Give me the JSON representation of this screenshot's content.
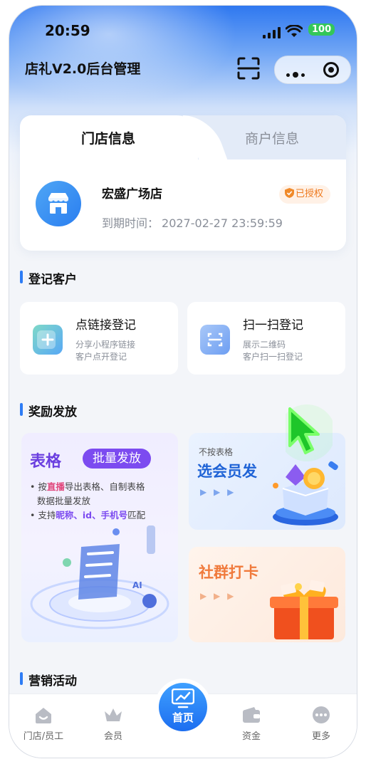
{
  "status_bar": {
    "time": "20:59",
    "battery": "100"
  },
  "nav": {
    "title": "店礼V2.0后台管理"
  },
  "store_tabs": [
    {
      "label": "门店信息"
    },
    {
      "label": "商户信息"
    }
  ],
  "store": {
    "name": "宏盛广场店",
    "auth_badge": "已授权",
    "expire_label": "到期时间：",
    "expire_value": "2027-02-27 23:59:59"
  },
  "sections": {
    "register": "登记客户",
    "reward": "奖励发放",
    "marketing": "营销活动"
  },
  "register": {
    "link": {
      "title": "点链接登记",
      "desc1": "分享小程序链接",
      "desc2": "客户点开登记"
    },
    "scan": {
      "title": "扫一扫登记",
      "desc1": "展示二维码",
      "desc2": "客户扫一扫登记"
    }
  },
  "reward": {
    "table": {
      "title": "表格",
      "badge": "批量发放",
      "line1_a": "• 按",
      "line1_b": "直播",
      "line1_c": "导出表格、自制表格",
      "line2": "数据批量发放",
      "line3_a": "• 支持",
      "line3_b": "昵称、id、手机号",
      "line3_c": "匹配",
      "art_text": "AI"
    },
    "select": {
      "sub": "不按表格",
      "title": "选会员发",
      "arrows": "▶ ▶ ▶"
    },
    "group": {
      "title": "社群打卡",
      "arrows": "▶ ▶ ▶"
    }
  },
  "tabbar": [
    {
      "label": "门店/员工",
      "icon": "home-icon"
    },
    {
      "label": "会员",
      "icon": "crown-icon"
    },
    {
      "label": "首页",
      "icon": "chart-icon"
    },
    {
      "label": "资金",
      "icon": "wallet-icon"
    },
    {
      "label": "更多",
      "icon": "more-icon"
    }
  ],
  "colors": {
    "primary": "#2d7cf5",
    "purple": "#7c4bf0",
    "orange": "#f07a3c",
    "cursor": "#3ddc3a"
  }
}
